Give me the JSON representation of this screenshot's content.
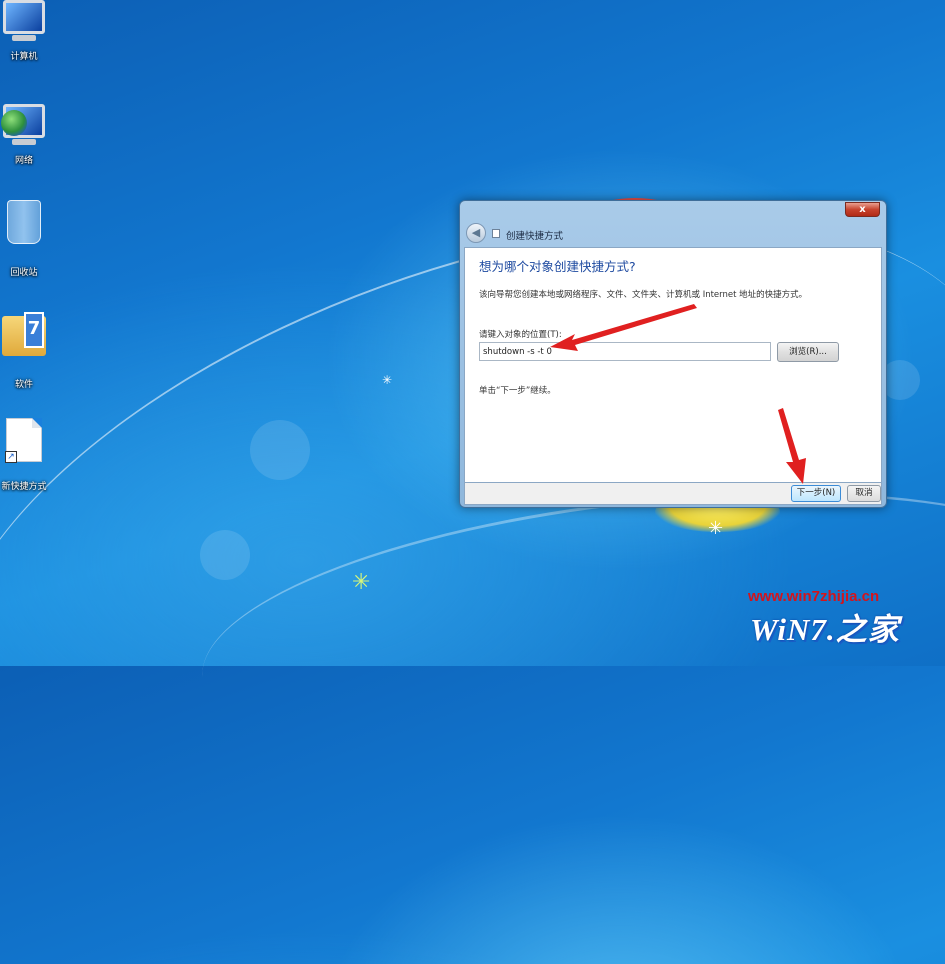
{
  "desktop": {
    "icons": [
      {
        "label": "计算机",
        "icon": "computer-icon"
      },
      {
        "label": "网络",
        "icon": "network-icon"
      },
      {
        "label": "回收站",
        "icon": "recycle-bin-icon"
      },
      {
        "label": "软件",
        "icon": "folder-icon"
      },
      {
        "label": "新快捷方式",
        "icon": "shortcut-file-icon"
      }
    ]
  },
  "dialog": {
    "title": "创建快捷方式",
    "close_label": "x",
    "heading": "想为哪个对象创建快捷方式?",
    "description": "该向导帮您创建本地或网络程序、文件、文件夹、计算机或 Internet 地址的快捷方式。",
    "location_label": "请键入对象的位置(T):",
    "location_value": "shutdown -s -t 0",
    "browse_label": "浏览(R)...",
    "hint": "单击“下一步”继续。",
    "next_label": "下一步(N)",
    "cancel_label": "取消"
  },
  "watermark": {
    "url": "www.win7zhijia.cn",
    "logo_text": "WiN7.之家"
  },
  "colors": {
    "annotation_arrow": "#e02020",
    "heading_blue": "#1e4aa0"
  }
}
